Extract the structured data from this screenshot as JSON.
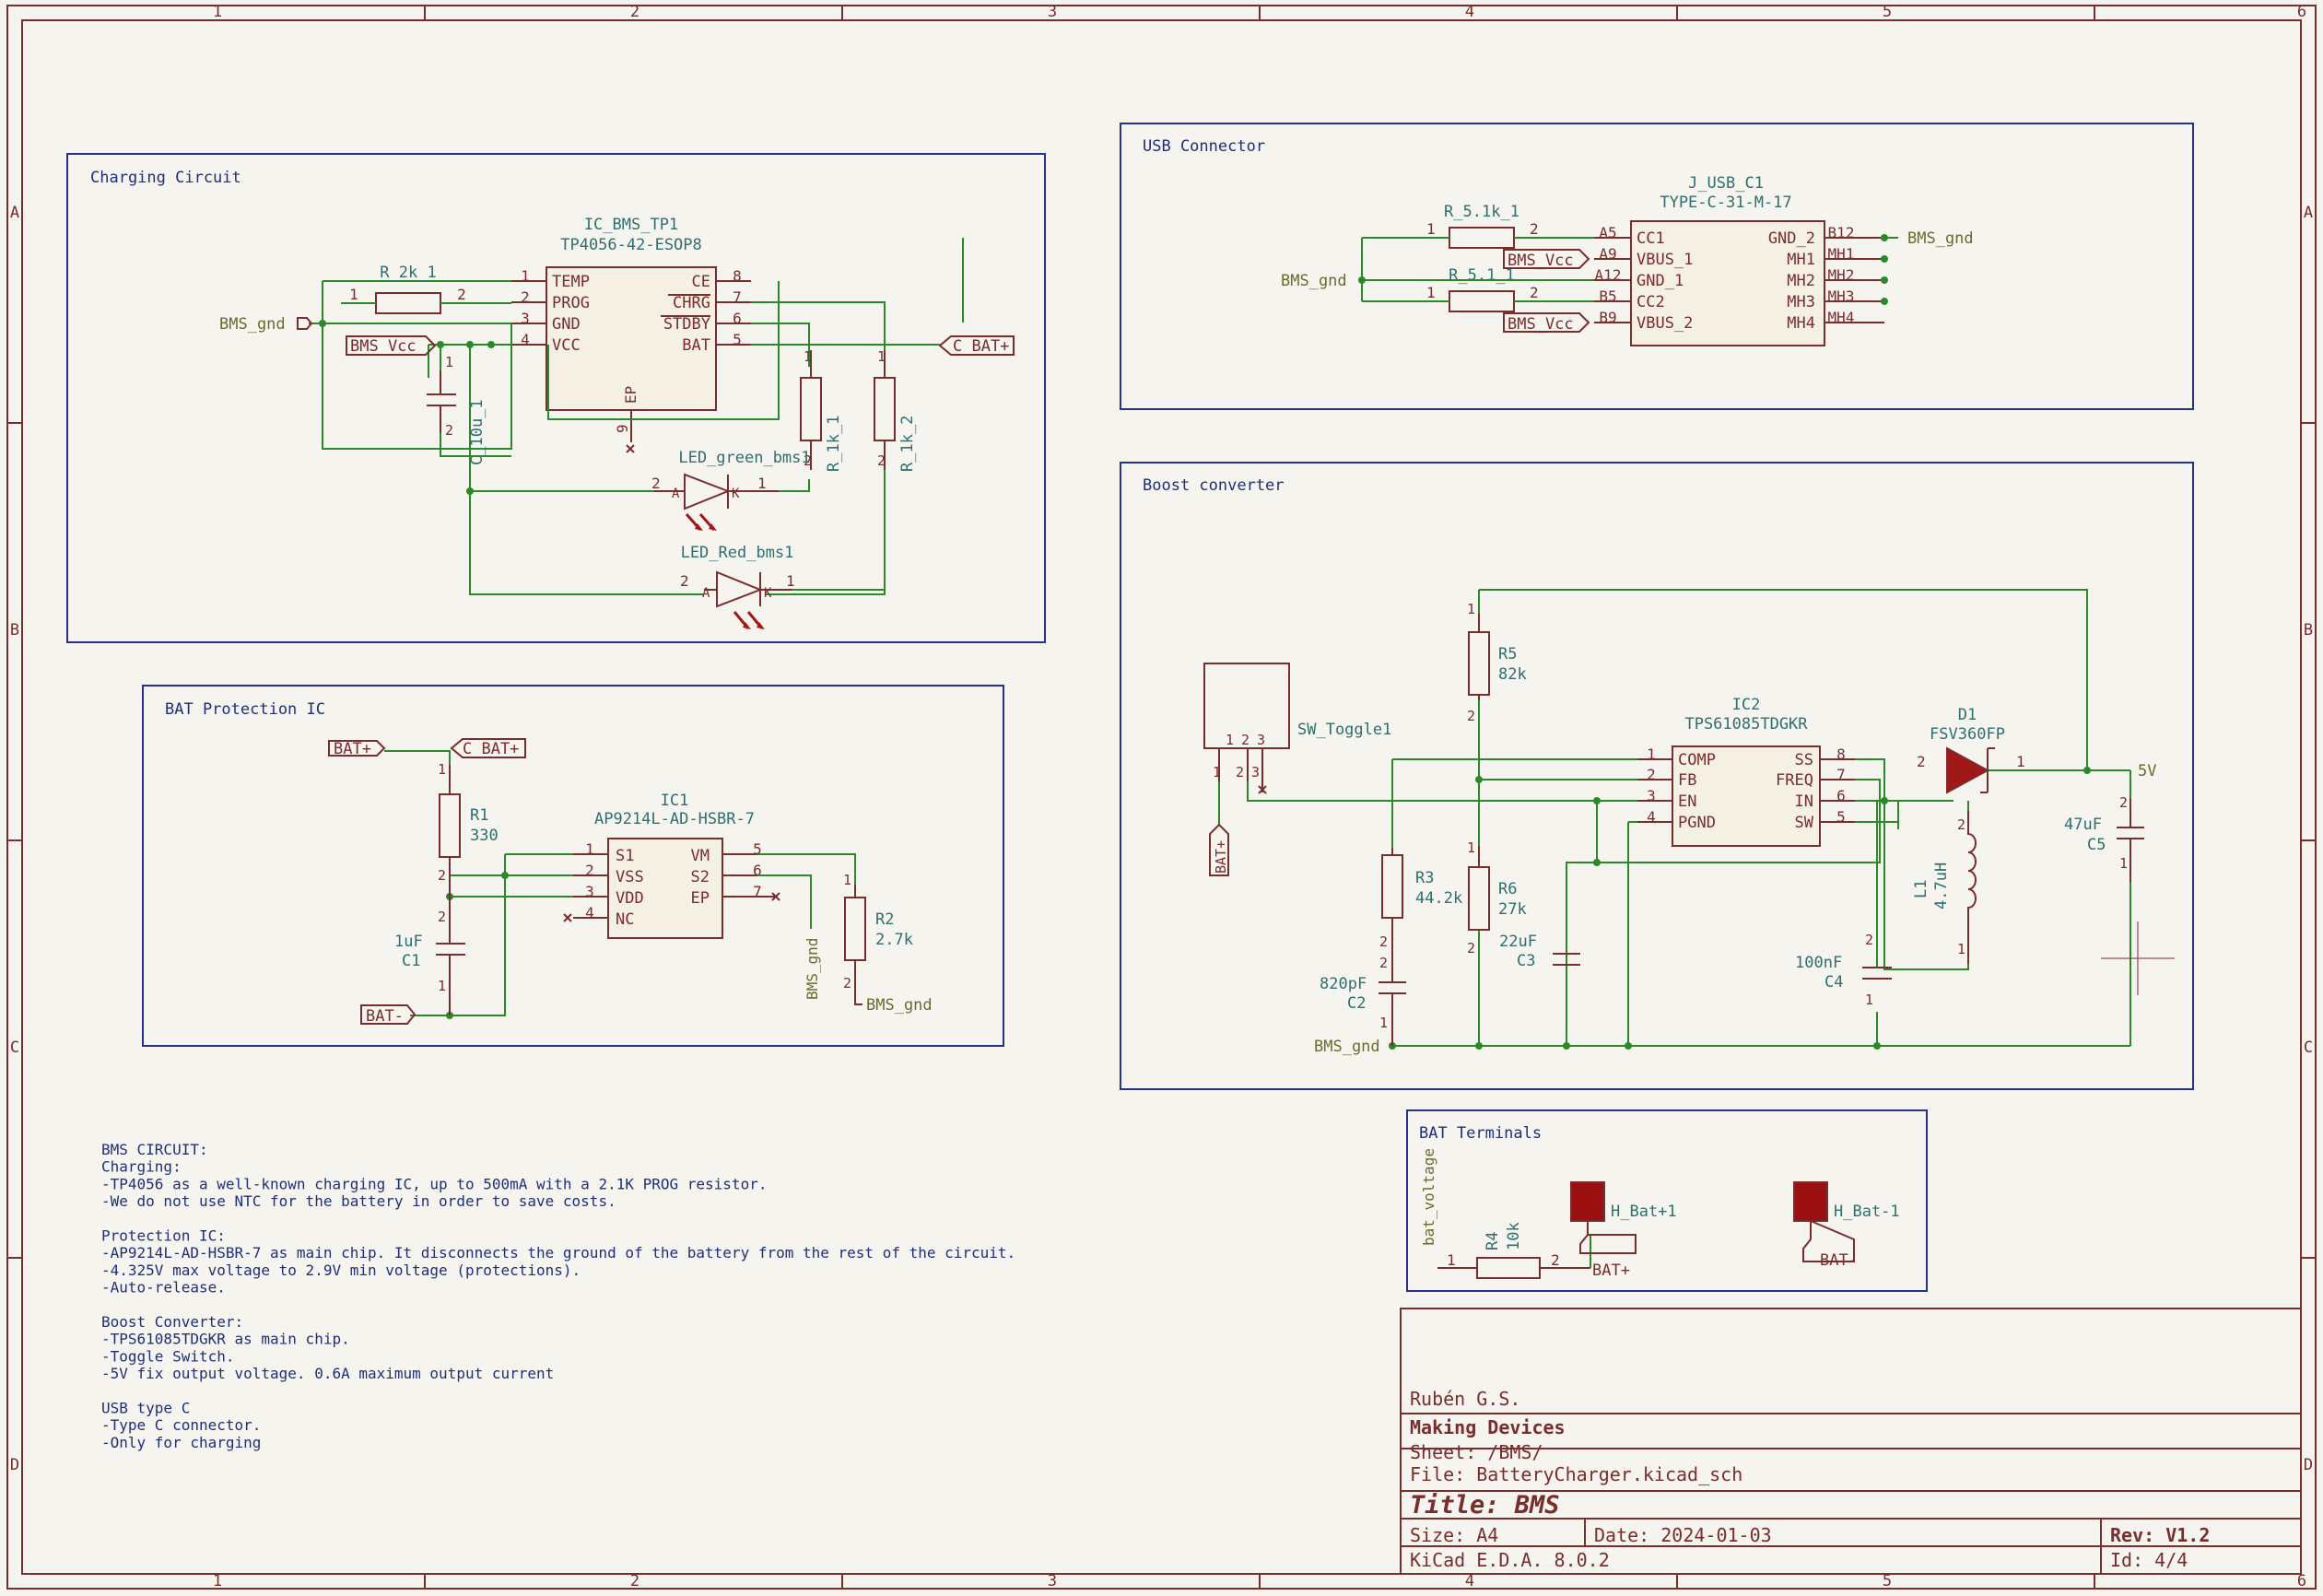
{
  "frame": {
    "cols": [
      "1",
      "2",
      "3",
      "4",
      "5",
      "6"
    ],
    "rows": [
      "A",
      "B",
      "C",
      "D"
    ]
  },
  "blocks": {
    "charging": "Charging Circuit",
    "usb": "USB Connector",
    "protection": "BAT Protection IC",
    "boost": "Boost converter",
    "terminals": "BAT Terminals"
  },
  "charging": {
    "ic_ref": "IC_BMS_TP1",
    "ic_value": "TP4056-42-ESOP8",
    "left_pins": [
      {
        "num": "1",
        "name": "TEMP"
      },
      {
        "num": "2",
        "name": "PROG"
      },
      {
        "num": "3",
        "name": "GND"
      },
      {
        "num": "4",
        "name": "VCC"
      }
    ],
    "right_pins": [
      {
        "num": "8",
        "name": "CE"
      },
      {
        "num": "7",
        "name": "CHRG"
      },
      {
        "num": "6",
        "name": "STDBY"
      },
      {
        "num": "5",
        "name": "BAT"
      }
    ],
    "ep_name": "EP",
    "ep_num": "9",
    "r_prog": "R_2k_1",
    "cap": "C_10u_1",
    "r_led1": "R_1k_1",
    "r_led2": "R_1k_2",
    "led_green": "LED_green_bms1",
    "led_red": "LED_Red_bms1",
    "gnd_label": "BMS_gnd",
    "vcc_label": "BMS_Vcc",
    "bat_label": "C_BAT+"
  },
  "usb": {
    "ref": "J_USB_C1",
    "value": "TYPE-C-31-M-17",
    "r1": "R_5.1k_1",
    "r2": "R_5.1_1",
    "left_pins": [
      {
        "num": "A5",
        "name": "CC1"
      },
      {
        "num": "A9",
        "name": "VBUS_1"
      },
      {
        "num": "A12",
        "name": "GND_1"
      },
      {
        "num": "B5",
        "name": "CC2"
      },
      {
        "num": "B9",
        "name": "VBUS_2"
      }
    ],
    "right_pins": [
      {
        "num": "B12",
        "name": "GND_2"
      },
      {
        "num": "MH1",
        "name": "MH1"
      },
      {
        "num": "MH2",
        "name": "MH2"
      },
      {
        "num": "MH3",
        "name": "MH3"
      },
      {
        "num": "MH4",
        "name": "MH4"
      }
    ],
    "gnd_label": "BMS_gnd",
    "vcc_label": "BMS_Vcc"
  },
  "protection": {
    "ic_ref": "IC1",
    "ic_value": "AP9214L-AD-HSBR-7",
    "left_pins": [
      {
        "num": "1",
        "name": "S1"
      },
      {
        "num": "2",
        "name": "VSS"
      },
      {
        "num": "3",
        "name": "VDD"
      },
      {
        "num": "4",
        "name": "NC"
      }
    ],
    "right_pins": [
      {
        "num": "5",
        "name": "VM"
      },
      {
        "num": "6",
        "name": "S2"
      },
      {
        "num": "7",
        "name": "EP"
      }
    ],
    "r1_ref": "R1",
    "r1_val": "330",
    "c1_ref": "C1",
    "c1_val": "1uF",
    "r2_ref": "R2",
    "r2_val": "2.7k",
    "bat_plus": "BAT+",
    "c_bat_plus": "C_BAT+",
    "bat_minus": "BAT-",
    "gnd_label": "BMS_gnd"
  },
  "boost": {
    "ic_ref": "IC2",
    "ic_value": "TPS61085TDGKR",
    "left_pins": [
      {
        "num": "1",
        "name": "COMP"
      },
      {
        "num": "2",
        "name": "FB"
      },
      {
        "num": "3",
        "name": "EN"
      },
      {
        "num": "4",
        "name": "PGND"
      }
    ],
    "right_pins": [
      {
        "num": "8",
        "name": "SS"
      },
      {
        "num": "7",
        "name": "FREQ"
      },
      {
        "num": "6",
        "name": "IN"
      },
      {
        "num": "5",
        "name": "SW"
      }
    ],
    "sw": "SW_Toggle1",
    "r5_ref": "R5",
    "r5_val": "82k",
    "r3_ref": "R3",
    "r3_val": "44.2k",
    "r6_ref": "R6",
    "r6_val": "27k",
    "c2_ref": "C2",
    "c2_val": "820pF",
    "c3_ref": "C3",
    "c3_val": "22uF",
    "c4_ref": "C4",
    "c4_val": "100nF",
    "c5_ref": "C5",
    "c5_val": "47uF",
    "l1_ref": "L1",
    "l1_val": "4.7uH",
    "d1_ref": "D1",
    "d1_val": "FSV360FP",
    "out_label": "5V",
    "gnd_label": "BMS_gnd",
    "bat_label": "BAT+"
  },
  "terminals": {
    "r4_ref": "R4",
    "r4_val": "10k",
    "bat_voltage": "bat_voltage",
    "h1": "H_Bat+1",
    "h2": "H_Bat-1",
    "bat_plus": "BAT+",
    "bat_minus": "BAT-"
  },
  "notes": [
    "BMS CIRCUIT:",
    "Charging:",
    "-TP4056 as a well-known charging IC, up to 500mA with a 2.1K PROG resistor.",
    "-We do not use NTC for the battery in order to save costs.",
    "",
    "Protection IC:",
    "-AP9214L-AD-HSBR-7 as main chip. It disconnects the ground of the battery from the rest of the circuit.",
    "-4.325V max voltage to 2.9V min voltage (protections).",
    "-Auto-release.",
    "",
    "Boost Converter:",
    "-TPS61085TDGKR as main chip.",
    "-Toggle Switch.",
    "-5V fix output voltage. 0.6A maximum output current",
    "",
    "USB type C",
    "-Type C connector.",
    "-Only for charging"
  ],
  "title_block": {
    "author": "Rubén G.S.",
    "company": "Making Devices",
    "sheet": "Sheet: /BMS/",
    "file": "File: BatteryCharger.kicad_sch",
    "title": "Title: BMS",
    "size": "Size: A4",
    "date": "Date: 2024-01-03",
    "rev": "Rev: V1.2",
    "tool": "KiCad E.D.A. 8.0.2",
    "id": "Id: 4/4"
  }
}
